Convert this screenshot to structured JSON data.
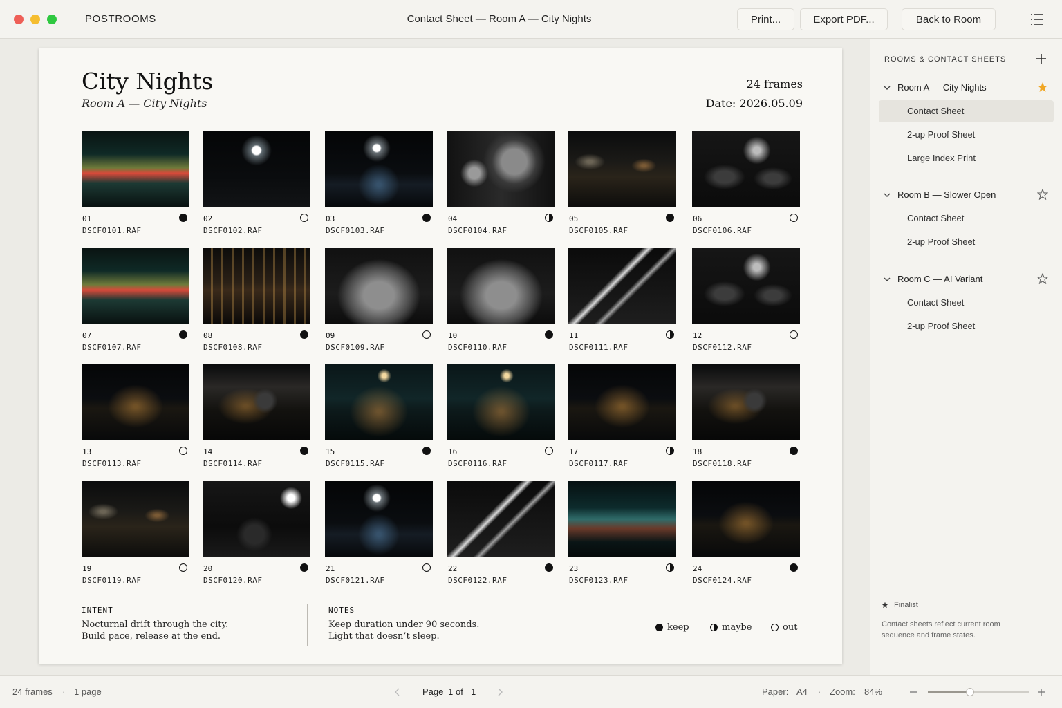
{
  "window": {
    "app_name": "POSTROOMS",
    "title": "Contact Sheet — Room A — City Nights",
    "buttons": {
      "print": "Print...",
      "export": "Export PDF...",
      "back": "Back to Room"
    }
  },
  "sheet": {
    "title": "City Nights",
    "subtitle": "Room A — City Nights",
    "frame_count": "24 frames",
    "date": "Date: 2026.05.09",
    "frames": [
      {
        "num": "01",
        "file": "DSCF0101.RAF",
        "state": "keep",
        "scene": "blur-color"
      },
      {
        "num": "02",
        "file": "DSCF0102.RAF",
        "state": "out",
        "scene": "lone-light"
      },
      {
        "num": "03",
        "file": "DSCF0103.RAF",
        "state": "keep",
        "scene": "lone-light-reflect"
      },
      {
        "num": "04",
        "file": "DSCF0104.RAF",
        "state": "maybe",
        "scene": "portrait"
      },
      {
        "num": "05",
        "file": "DSCF0105.RAF",
        "state": "keep",
        "scene": "street"
      },
      {
        "num": "06",
        "file": "DSCF0106.RAF",
        "state": "out",
        "scene": "crowd"
      },
      {
        "num": "07",
        "file": "DSCF0107.RAF",
        "state": "keep",
        "scene": "blur-color"
      },
      {
        "num": "08",
        "file": "DSCF0108.RAF",
        "state": "keep",
        "scene": "windows"
      },
      {
        "num": "09",
        "file": "DSCF0109.RAF",
        "state": "out",
        "scene": "car"
      },
      {
        "num": "10",
        "file": "DSCF0110.RAF",
        "state": "keep",
        "scene": "car"
      },
      {
        "num": "11",
        "file": "DSCF0111.RAF",
        "state": "maybe",
        "scene": "streaks"
      },
      {
        "num": "12",
        "file": "DSCF0112.RAF",
        "state": "out",
        "scene": "crowd"
      },
      {
        "num": "13",
        "file": "DSCF0113.RAF",
        "state": "out",
        "scene": "skyline"
      },
      {
        "num": "14",
        "file": "DSCF0114.RAF",
        "state": "keep",
        "scene": "skyline-figure"
      },
      {
        "num": "15",
        "file": "DSCF0115.RAF",
        "state": "keep",
        "scene": "teal-skyline"
      },
      {
        "num": "16",
        "file": "DSCF0116.RAF",
        "state": "out",
        "scene": "teal-skyline"
      },
      {
        "num": "17",
        "file": "DSCF0117.RAF",
        "state": "maybe",
        "scene": "skyline"
      },
      {
        "num": "18",
        "file": "DSCF0118.RAF",
        "state": "keep",
        "scene": "skyline-figure"
      },
      {
        "num": "19",
        "file": "DSCF0119.RAF",
        "state": "out",
        "scene": "street"
      },
      {
        "num": "20",
        "file": "DSCF0120.RAF",
        "state": "keep",
        "scene": "walkers"
      },
      {
        "num": "21",
        "file": "DSCF0121.RAF",
        "state": "out",
        "scene": "lone-light-reflect"
      },
      {
        "num": "22",
        "file": "DSCF0122.RAF",
        "state": "keep",
        "scene": "streaks"
      },
      {
        "num": "23",
        "file": "DSCF0123.RAF",
        "state": "maybe",
        "scene": "blur-teal"
      },
      {
        "num": "24",
        "file": "DSCF0124.RAF",
        "state": "keep",
        "scene": "skyline"
      }
    ],
    "intent": {
      "label": "INTENT",
      "line1": "Nocturnal drift through the city.",
      "line2": "Build pace, release at the end."
    },
    "notes": {
      "label": "NOTES",
      "line1": "Keep duration under 90 seconds.",
      "line2": "Light that doesn’t sleep."
    },
    "legend": {
      "keep": "keep",
      "maybe": "maybe",
      "out": "out"
    }
  },
  "sidebar": {
    "heading": "ROOMS & CONTACT SHEETS",
    "rooms": [
      {
        "label": "Room A — City Nights",
        "finalist": true,
        "items": [
          "Contact Sheet",
          "2-up Proof Sheet",
          "Large Index Print"
        ]
      },
      {
        "label": "Room B — Slower Open",
        "finalist": false,
        "items": [
          "Contact Sheet",
          "2-up Proof Sheet"
        ]
      },
      {
        "label": "Room C — AI Variant",
        "finalist": false,
        "items": [
          "Contact Sheet",
          "2-up Proof Sheet"
        ]
      }
    ],
    "finalist_label": "Finalist",
    "note": "Contact sheets reflect current room sequence and frame states."
  },
  "statusbar": {
    "frames": "24 frames",
    "sep": "·",
    "pages": "1 page",
    "page_label": "Page",
    "page_current": "1",
    "page_of": "of",
    "page_total": "1",
    "paper_label": "Paper:",
    "paper_value": "A4",
    "zoom_label": "Zoom:",
    "zoom_value": "84%",
    "zoom_fraction": 0.42
  },
  "colors": {
    "accent_star": "#f0a623",
    "keep": "#111111",
    "paper": "#f9f8f4"
  }
}
